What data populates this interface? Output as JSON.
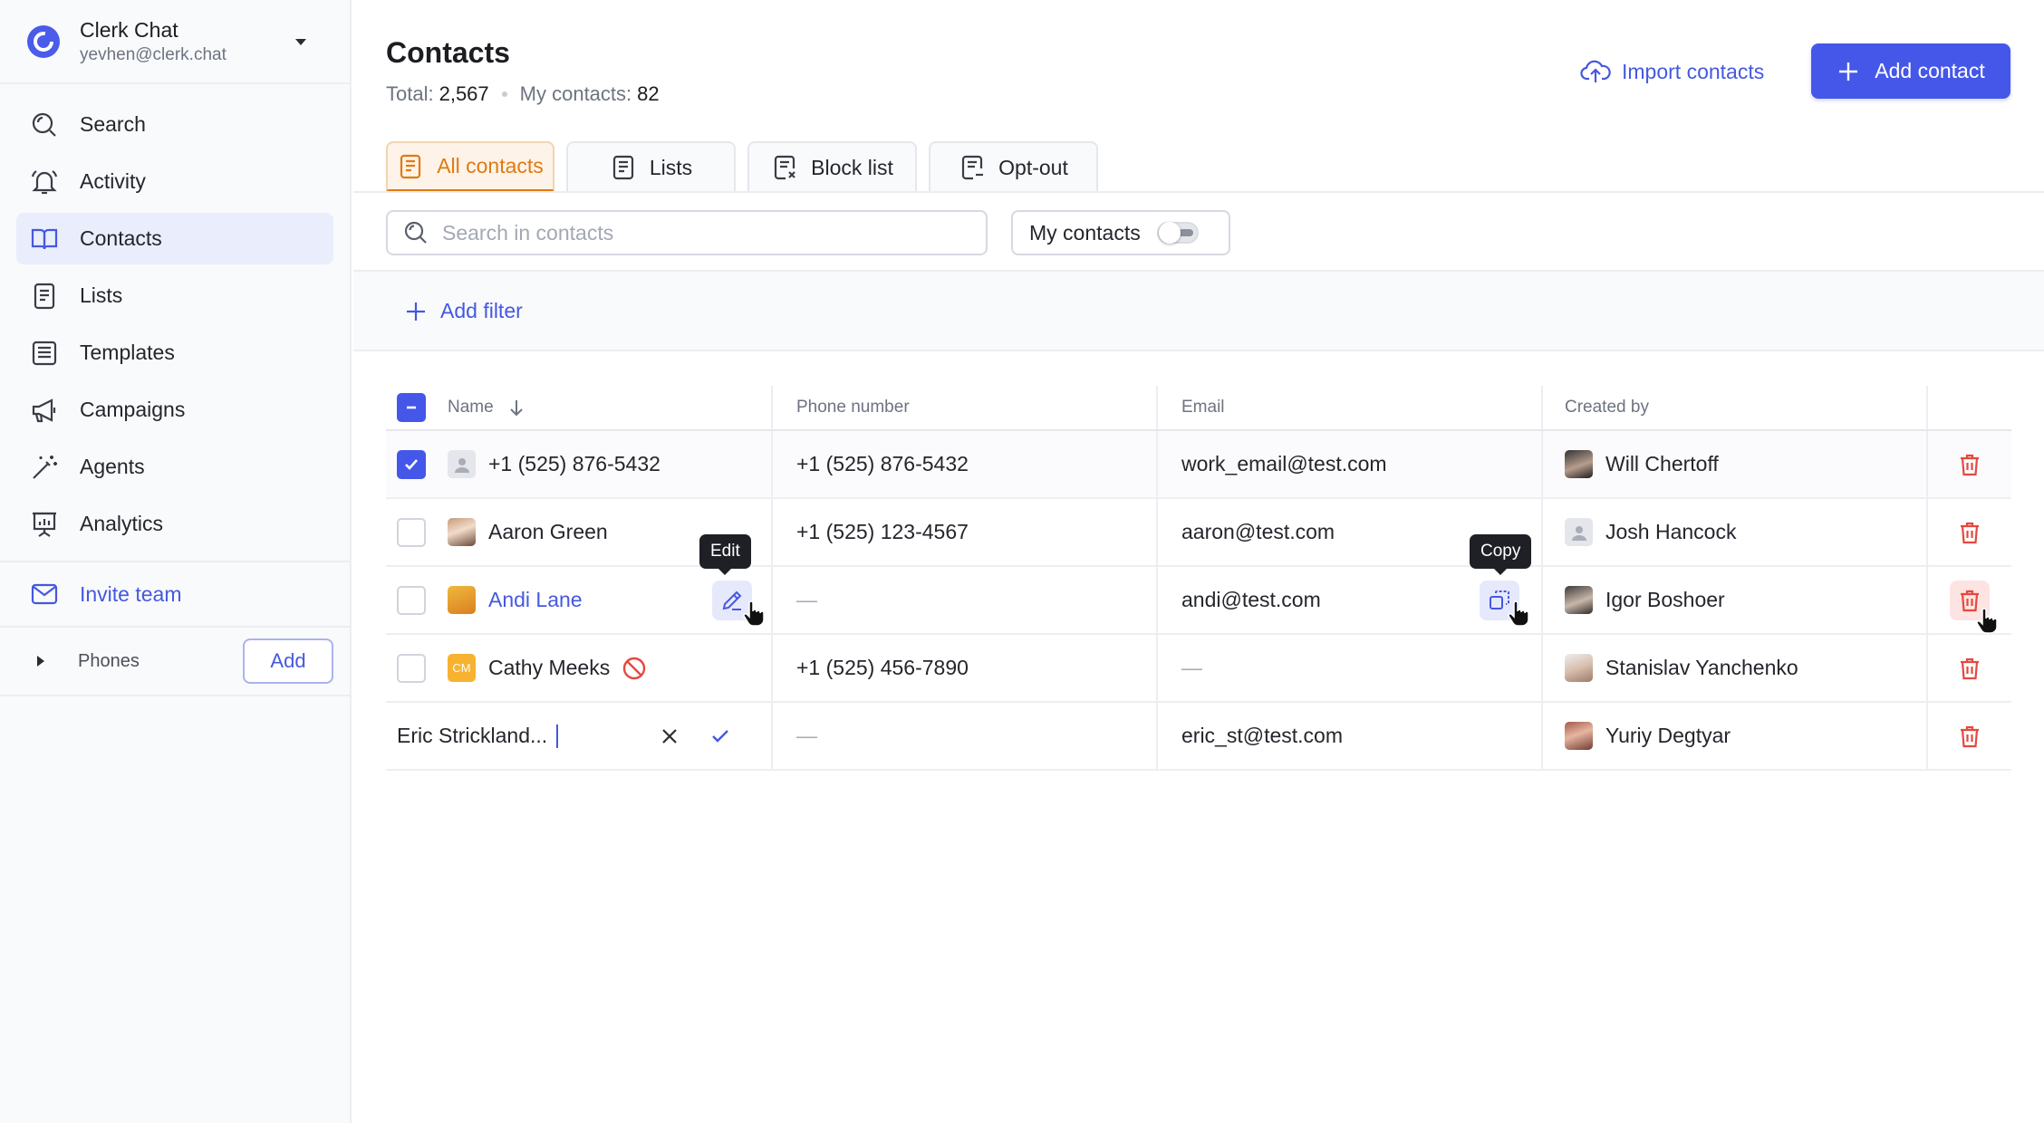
{
  "app": {
    "name": "Clerk Chat",
    "email": "yevhen@clerk.chat"
  },
  "nav": {
    "items": [
      {
        "label": "Search",
        "icon": "search-icon"
      },
      {
        "label": "Activity",
        "icon": "bell-icon"
      },
      {
        "label": "Contacts",
        "icon": "book-icon",
        "active": true
      },
      {
        "label": "Lists",
        "icon": "list-icon"
      },
      {
        "label": "Templates",
        "icon": "templates-icon"
      },
      {
        "label": "Campaigns",
        "icon": "megaphone-icon"
      },
      {
        "label": "Agents",
        "icon": "magic-wand-icon"
      },
      {
        "label": "Analytics",
        "icon": "presentation-chart-icon"
      }
    ],
    "invite": "Invite team",
    "phones_label": "Phones",
    "phones_add": "Add"
  },
  "header": {
    "title": "Contacts",
    "total_label": "Total:",
    "total_value": "2,567",
    "my_label": "My contacts:",
    "my_value": "82",
    "import_label": "Import contacts",
    "add_label": "Add contact"
  },
  "tabs": [
    {
      "label": "All contacts",
      "active": true
    },
    {
      "label": "Lists"
    },
    {
      "label": "Block list"
    },
    {
      "label": "Opt-out"
    }
  ],
  "toolbar": {
    "search_placeholder": "Search in contacts",
    "my_contacts_label": "My contacts",
    "my_contacts_on": false,
    "add_filter": "Add filter"
  },
  "table": {
    "columns": [
      "Name",
      "Phone number",
      "Email",
      "Created by"
    ],
    "rows": [
      {
        "name": "+1 (525) 876-5432",
        "phone": "+1 (525) 876-5432",
        "email": "work_email@test.com",
        "created_by": "Will Chertoff",
        "checked": true
      },
      {
        "name": "Aaron Green",
        "phone": "+1 (525) 123-4567",
        "email": "aaron@test.com",
        "created_by": "Josh Hancock",
        "checked": false
      },
      {
        "name": "Andi Lane",
        "phone": "—",
        "email": "andi@test.com",
        "created_by": "Igor Boshoer",
        "checked": false
      },
      {
        "name": "Cathy Meeks",
        "phone": "+1 (525) 456-7890",
        "email": "—",
        "created_by": "Stanislav Yanchenko",
        "checked": false,
        "avatar_initials": "CM"
      },
      {
        "name": "Eric Strickland...",
        "phone": "—",
        "email": "eric_st@test.com",
        "created_by": "Yuriy Degtyar",
        "editing": true
      }
    ],
    "tooltip_edit": "Edit",
    "tooltip_copy": "Copy"
  },
  "colors": {
    "accent": "#4557e8",
    "tab_active": "#e07a12",
    "danger": "#e5483f"
  }
}
